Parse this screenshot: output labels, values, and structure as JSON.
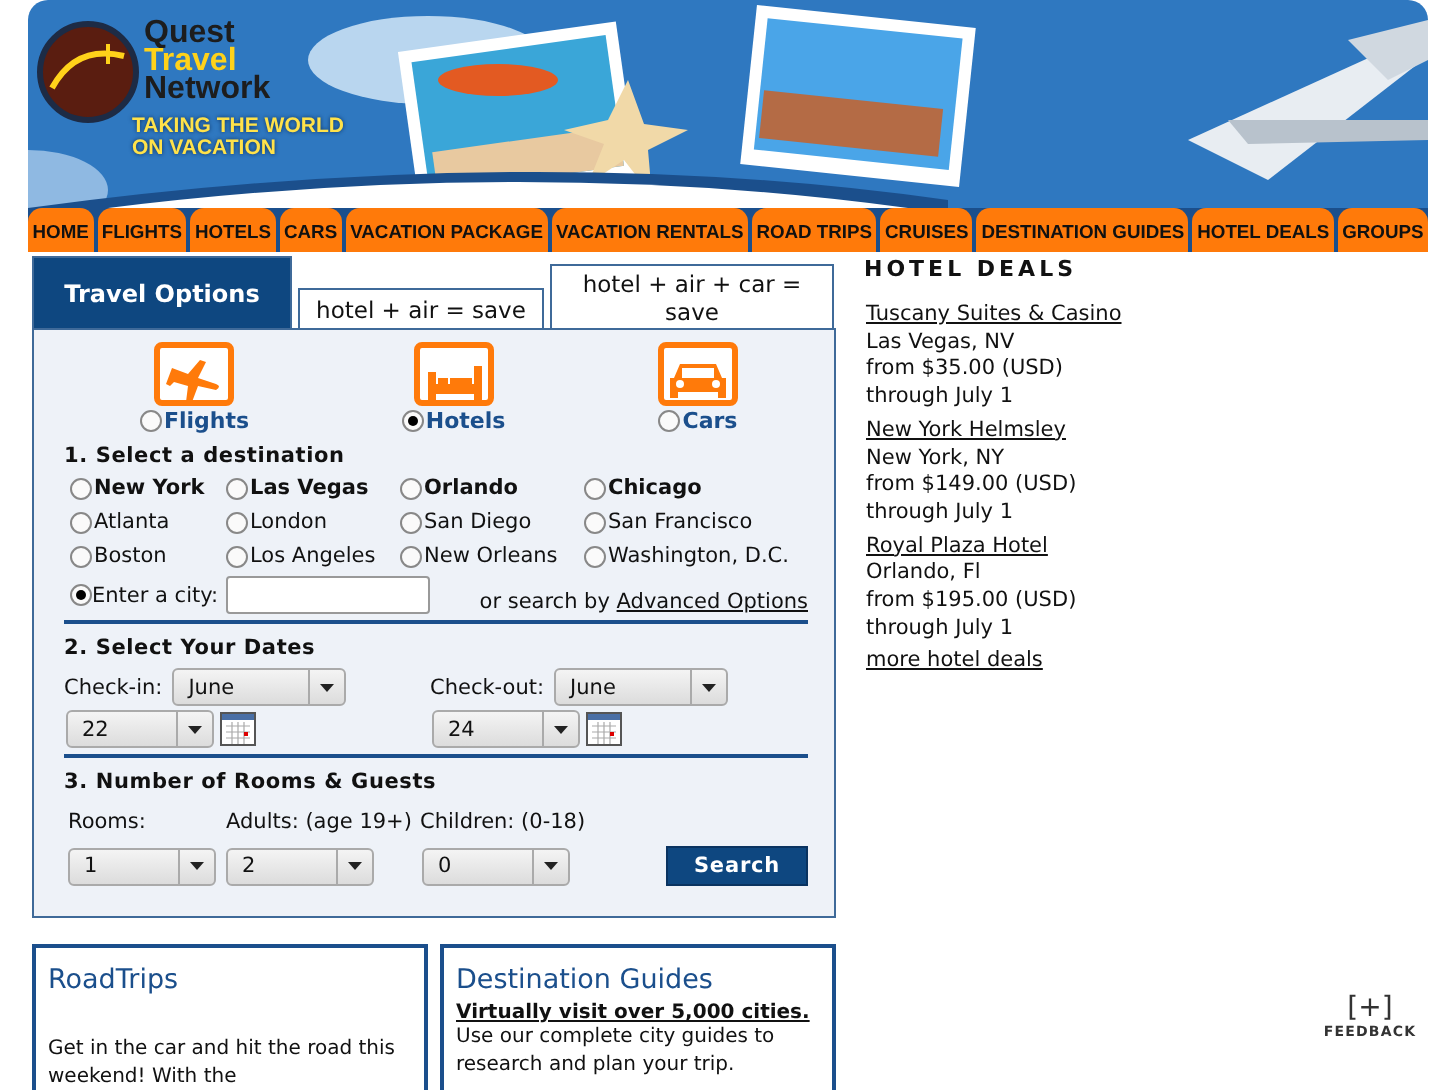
{
  "logo": {
    "name_lines": [
      "Quest",
      "Travel",
      "Network"
    ],
    "tagline_lines": [
      "TAKING THE WORLD",
      "ON VACATION"
    ]
  },
  "nav": [
    {
      "label": "HOME"
    },
    {
      "label": "FLIGHTS"
    },
    {
      "label": "HOTELS"
    },
    {
      "label": "CARS"
    },
    {
      "label": "VACATION PACKAGE"
    },
    {
      "label": "VACATION RENTALS"
    },
    {
      "label": "ROAD TRIPS"
    },
    {
      "label": "CRUISES"
    },
    {
      "label": "DESTINATION GUIDES"
    },
    {
      "label": "HOTEL DEALS"
    },
    {
      "label": "GROUPS"
    }
  ],
  "tabs": [
    {
      "label": "Travel Options",
      "selected": true
    },
    {
      "label": "hotel + air = save",
      "selected": false
    },
    {
      "label": "hotel + air + car = save",
      "selected": false
    }
  ],
  "products": [
    {
      "label": "Flights",
      "kind": "plane",
      "selected": false
    },
    {
      "label": "Hotels",
      "kind": "bed",
      "selected": true
    },
    {
      "label": "Cars",
      "kind": "car",
      "selected": false
    }
  ],
  "destination": {
    "heading": "1. Select a destination",
    "cities": [
      {
        "label": "New York",
        "popular": true,
        "selected": false
      },
      {
        "label": "Las Vegas",
        "popular": true,
        "selected": false
      },
      {
        "label": "Orlando",
        "popular": true,
        "selected": false
      },
      {
        "label": "Chicago",
        "popular": true,
        "selected": false
      },
      {
        "label": "Atlanta",
        "popular": false,
        "selected": false
      },
      {
        "label": "London",
        "popular": false,
        "selected": false
      },
      {
        "label": "San Diego",
        "popular": false,
        "selected": false
      },
      {
        "label": "San Francisco",
        "popular": false,
        "selected": false
      },
      {
        "label": "Boston",
        "popular": false,
        "selected": false
      },
      {
        "label": "Los Angeles",
        "popular": false,
        "selected": false
      },
      {
        "label": "New Orleans",
        "popular": false,
        "selected": false
      },
      {
        "label": "Washington, D.C.",
        "popular": false,
        "selected": false
      }
    ],
    "other": {
      "label": "Enter a city:",
      "selected": true
    },
    "advanced_prefix": "or search by",
    "advanced_link": "Advanced Options"
  },
  "dates": {
    "heading": "2. Select Your Dates",
    "fields": [
      {
        "label": "Check-in:",
        "month": "June",
        "day": "22"
      },
      {
        "label": "Check-out:",
        "month": "June",
        "day": "24"
      }
    ]
  },
  "guests": {
    "heading": "3. Number of Rooms & Guests",
    "fields": [
      {
        "label": "Rooms:",
        "value": "1"
      },
      {
        "label": "Adults: (age 19+)",
        "value": "2"
      },
      {
        "label": "Children: (0-18)",
        "value": "0"
      }
    ],
    "button": "Search"
  },
  "hotel_deals": {
    "title": "HOTEL DEALS",
    "deals": [
      {
        "name": "Tuscany Suites & Casino",
        "city": "Las Vegas, NV",
        "price": "from $35.00 (USD)",
        "through": "through July 1"
      },
      {
        "name": "New York Helmsley",
        "city": "New York, NY",
        "price": "from $149.00 (USD)",
        "through": "through July 1"
      },
      {
        "name": "Royal Plaza Hotel",
        "city": "Orlando, Fl",
        "price": "from $195.00 (USD)",
        "through": "through July 1"
      }
    ],
    "more": "more hotel deals"
  },
  "cards": [
    {
      "title": "RoadTrips",
      "text": "Get in the car and hit the road this weekend! With the"
    },
    {
      "title": "Destination Guides",
      "lead": "Virtually visit over 5,000 cities.",
      "text": "Use our complete city guides to research and plan your trip."
    }
  ],
  "feedback": {
    "symbol": "[+]",
    "label": "FEEDBACK"
  }
}
